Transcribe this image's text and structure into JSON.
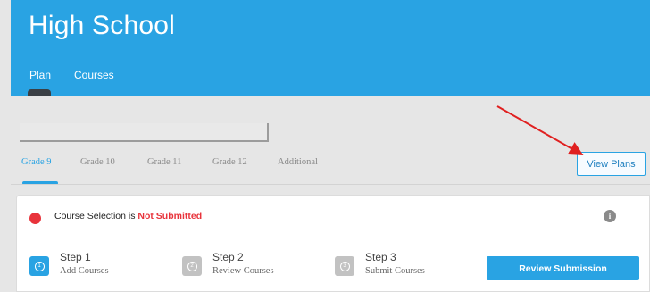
{
  "header": {
    "title": "High School",
    "nav": {
      "plan": "Plan",
      "courses": "Courses"
    }
  },
  "plan_selector": {
    "value": ""
  },
  "grade_tabs": [
    "Grade 9",
    "Grade 10",
    "Grade 11",
    "Grade 12",
    "Additional"
  ],
  "active_tab": "Grade 9",
  "view_plans_label": "View Plans",
  "status": {
    "prefix": "Course Selection is",
    "value": "Not Submitted",
    "indicator_color": "#e8333b",
    "info_icon": "i"
  },
  "steps": [
    {
      "number": "1",
      "title": "Step 1",
      "subtitle": "Add Courses",
      "state": "active"
    },
    {
      "number": "2",
      "title": "Step 2",
      "subtitle": "Review Courses",
      "state": "inactive"
    },
    {
      "number": "3",
      "title": "Step 3",
      "subtitle": "Submit Courses",
      "state": "inactive"
    }
  ],
  "review_button_label": "Review Submission",
  "colors": {
    "accent": "#29a3e3",
    "danger": "#e8333b",
    "annotation_arrow": "#e02020"
  }
}
